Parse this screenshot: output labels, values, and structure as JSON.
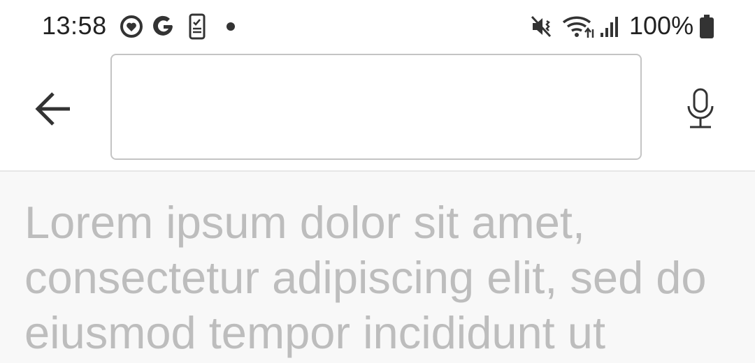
{
  "status_bar": {
    "time": "13:58",
    "battery": "100%",
    "icons": [
      "sync-heart-icon",
      "google-icon",
      "checklist-phone-icon",
      "notification-dot-icon",
      "mute-icon",
      "wifi-icon",
      "signal-icon",
      "battery-icon"
    ]
  },
  "toolbar": {
    "back_icon": "arrow-left-icon",
    "search_value": "",
    "search_placeholder": "",
    "mic_icon": "microphone-icon"
  },
  "content": {
    "text": "Lorem ipsum dolor sit amet, consectetur adipiscing elit, sed do eiusmod tempor incididunt ut"
  },
  "colors": {
    "content_background": "#f8f8f8",
    "placeholder_text": "#bdbdbd",
    "icon": "#333333"
  }
}
